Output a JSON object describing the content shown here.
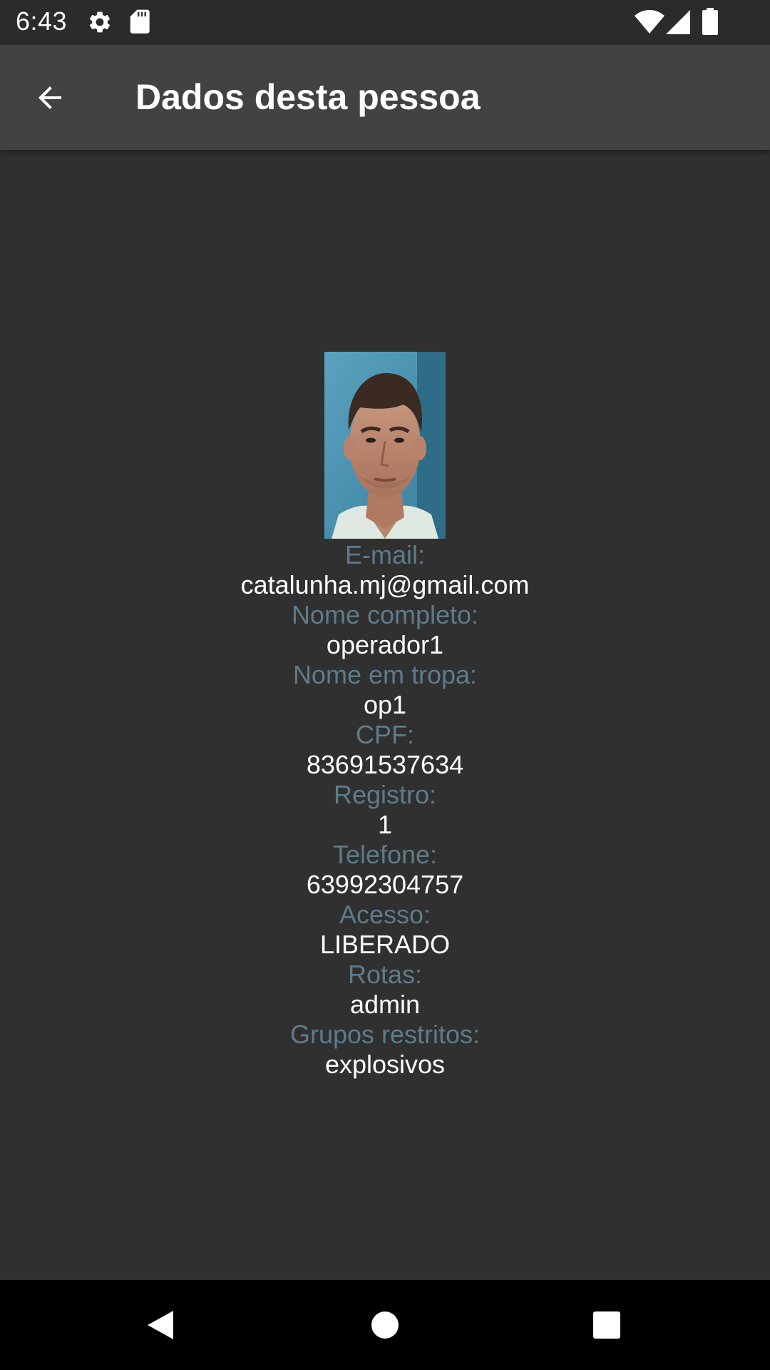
{
  "status_bar": {
    "time": "6:43",
    "icons": [
      "gear-icon",
      "sd-card-icon",
      "wifi-icon",
      "signal-icon",
      "battery-icon"
    ]
  },
  "app_bar": {
    "title": "Dados desta pessoa",
    "back_icon": "arrow-back-icon"
  },
  "profile": {
    "photo_alt": "person-photo",
    "fields": [
      {
        "label": "E-mail:",
        "value": "catalunha.mj@gmail.com"
      },
      {
        "label": "Nome completo:",
        "value": "operador1"
      },
      {
        "label": "Nome em tropa:",
        "value": "op1"
      },
      {
        "label": "CPF:",
        "value": "83691537634"
      },
      {
        "label": "Registro:",
        "value": "1"
      },
      {
        "label": "Telefone:",
        "value": "63992304757"
      },
      {
        "label": "Acesso:",
        "value": "LIBERADO"
      },
      {
        "label": "Rotas:",
        "value": "admin"
      },
      {
        "label": "Grupos restritos:",
        "value": "explosivos"
      }
    ]
  },
  "colors": {
    "background": "#303030",
    "app_bar": "#424242",
    "status_bar": "#2b2b2b",
    "label": "#5f7b89",
    "value": "#ffffff",
    "nav_bar": "#000000"
  },
  "nav_bar": {
    "icons": [
      "nav-back-icon",
      "nav-home-icon",
      "nav-recents-icon"
    ]
  }
}
